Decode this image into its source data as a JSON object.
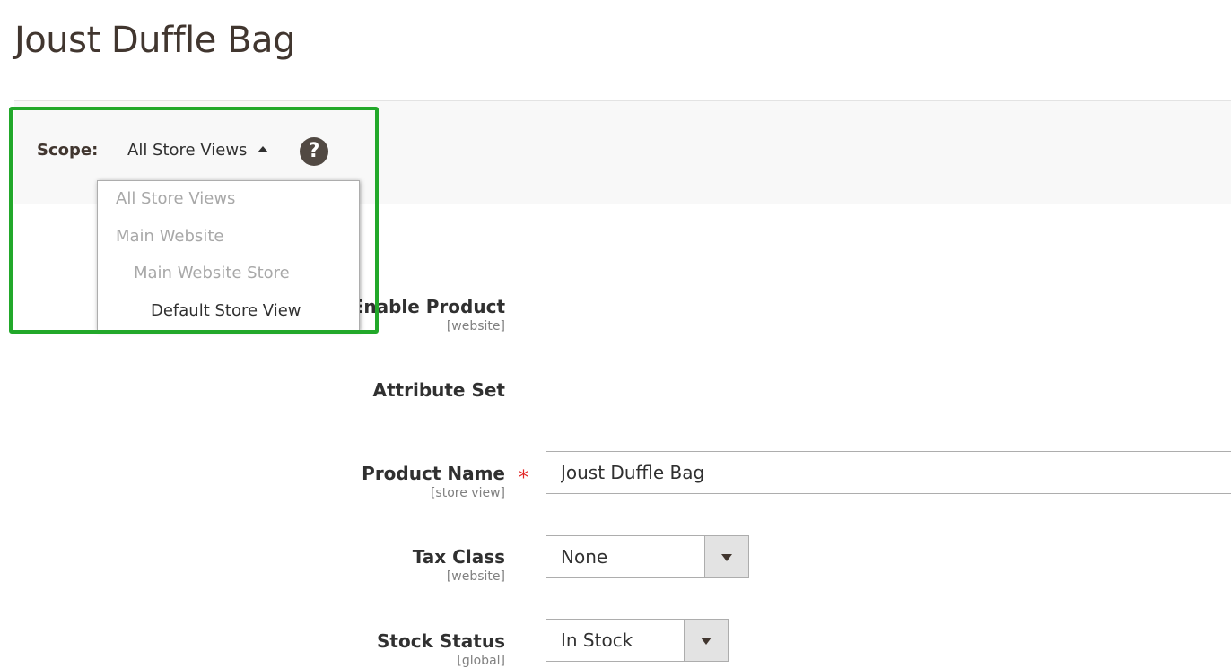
{
  "page": {
    "title": "Joust Duffle Bag"
  },
  "scope": {
    "label": "Scope:",
    "current": "All Store Views",
    "help_icon": "question-circle-icon",
    "options": [
      {
        "label": "All Store Views",
        "state": "disabled"
      },
      {
        "label": "Main Website",
        "state": "disabled"
      },
      {
        "label": "Main Website Store",
        "state": "disabled"
      },
      {
        "label": "Default Store View",
        "state": "active"
      }
    ]
  },
  "fields": {
    "enable_product": {
      "label": "Enable Product",
      "scope": "[website]"
    },
    "attribute_set": {
      "label": "Attribute Set"
    },
    "product_name": {
      "label": "Product Name",
      "scope": "[store view]",
      "required_mark": "*",
      "value": "Joust Duffle Bag"
    },
    "tax_class": {
      "label": "Tax Class",
      "scope": "[website]",
      "value": "None"
    },
    "stock_status": {
      "label": "Stock Status",
      "scope": "[global]",
      "value": "In Stock"
    }
  },
  "colors": {
    "highlight": "#22a82a",
    "required": "#e22626",
    "title": "#41362f"
  }
}
